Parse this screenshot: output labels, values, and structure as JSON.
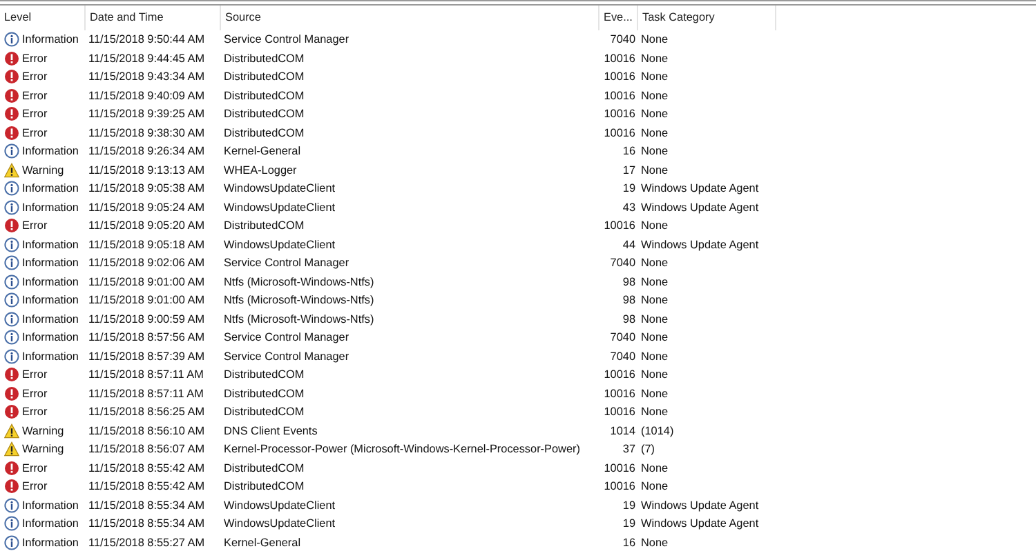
{
  "columns": [
    "Level",
    "Date and Time",
    "Source",
    "Eve...",
    "Task Category"
  ],
  "rows": [
    {
      "kind": "information",
      "level": "Information",
      "date": "11/15/2018 9:50:44 AM",
      "source": "Service Control Manager",
      "event": "7040",
      "task": "None"
    },
    {
      "kind": "error",
      "level": "Error",
      "date": "11/15/2018 9:44:45 AM",
      "source": "DistributedCOM",
      "event": "10016",
      "task": "None"
    },
    {
      "kind": "error",
      "level": "Error",
      "date": "11/15/2018 9:43:34 AM",
      "source": "DistributedCOM",
      "event": "10016",
      "task": "None"
    },
    {
      "kind": "error",
      "level": "Error",
      "date": "11/15/2018 9:40:09 AM",
      "source": "DistributedCOM",
      "event": "10016",
      "task": "None"
    },
    {
      "kind": "error",
      "level": "Error",
      "date": "11/15/2018 9:39:25 AM",
      "source": "DistributedCOM",
      "event": "10016",
      "task": "None"
    },
    {
      "kind": "error",
      "level": "Error",
      "date": "11/15/2018 9:38:30 AM",
      "source": "DistributedCOM",
      "event": "10016",
      "task": "None"
    },
    {
      "kind": "information",
      "level": "Information",
      "date": "11/15/2018 9:26:34 AM",
      "source": "Kernel-General",
      "event": "16",
      "task": "None"
    },
    {
      "kind": "warning",
      "level": "Warning",
      "date": "11/15/2018 9:13:13 AM",
      "source": "WHEA-Logger",
      "event": "17",
      "task": "None"
    },
    {
      "kind": "information",
      "level": "Information",
      "date": "11/15/2018 9:05:38 AM",
      "source": "WindowsUpdateClient",
      "event": "19",
      "task": "Windows Update Agent"
    },
    {
      "kind": "information",
      "level": "Information",
      "date": "11/15/2018 9:05:24 AM",
      "source": "WindowsUpdateClient",
      "event": "43",
      "task": "Windows Update Agent"
    },
    {
      "kind": "error",
      "level": "Error",
      "date": "11/15/2018 9:05:20 AM",
      "source": "DistributedCOM",
      "event": "10016",
      "task": "None"
    },
    {
      "kind": "information",
      "level": "Information",
      "date": "11/15/2018 9:05:18 AM",
      "source": "WindowsUpdateClient",
      "event": "44",
      "task": "Windows Update Agent"
    },
    {
      "kind": "information",
      "level": "Information",
      "date": "11/15/2018 9:02:06 AM",
      "source": "Service Control Manager",
      "event": "7040",
      "task": "None"
    },
    {
      "kind": "information",
      "level": "Information",
      "date": "11/15/2018 9:01:00 AM",
      "source": "Ntfs (Microsoft-Windows-Ntfs)",
      "event": "98",
      "task": "None"
    },
    {
      "kind": "information",
      "level": "Information",
      "date": "11/15/2018 9:01:00 AM",
      "source": "Ntfs (Microsoft-Windows-Ntfs)",
      "event": "98",
      "task": "None"
    },
    {
      "kind": "information",
      "level": "Information",
      "date": "11/15/2018 9:00:59 AM",
      "source": "Ntfs (Microsoft-Windows-Ntfs)",
      "event": "98",
      "task": "None"
    },
    {
      "kind": "information",
      "level": "Information",
      "date": "11/15/2018 8:57:56 AM",
      "source": "Service Control Manager",
      "event": "7040",
      "task": "None"
    },
    {
      "kind": "information",
      "level": "Information",
      "date": "11/15/2018 8:57:39 AM",
      "source": "Service Control Manager",
      "event": "7040",
      "task": "None"
    },
    {
      "kind": "error",
      "level": "Error",
      "date": "11/15/2018 8:57:11 AM",
      "source": "DistributedCOM",
      "event": "10016",
      "task": "None"
    },
    {
      "kind": "error",
      "level": "Error",
      "date": "11/15/2018 8:57:11 AM",
      "source": "DistributedCOM",
      "event": "10016",
      "task": "None"
    },
    {
      "kind": "error",
      "level": "Error",
      "date": "11/15/2018 8:56:25 AM",
      "source": "DistributedCOM",
      "event": "10016",
      "task": "None"
    },
    {
      "kind": "warning",
      "level": "Warning",
      "date": "11/15/2018 8:56:10 AM",
      "source": "DNS Client Events",
      "event": "1014",
      "task": "(1014)"
    },
    {
      "kind": "warning",
      "level": "Warning",
      "date": "11/15/2018 8:56:07 AM",
      "source": "Kernel-Processor-Power (Microsoft-Windows-Kernel-Processor-Power)",
      "event": "37",
      "task": "(7)"
    },
    {
      "kind": "error",
      "level": "Error",
      "date": "11/15/2018 8:55:42 AM",
      "source": "DistributedCOM",
      "event": "10016",
      "task": "None"
    },
    {
      "kind": "error",
      "level": "Error",
      "date": "11/15/2018 8:55:42 AM",
      "source": "DistributedCOM",
      "event": "10016",
      "task": "None"
    },
    {
      "kind": "information",
      "level": "Information",
      "date": "11/15/2018 8:55:34 AM",
      "source": "WindowsUpdateClient",
      "event": "19",
      "task": "Windows Update Agent"
    },
    {
      "kind": "information",
      "level": "Information",
      "date": "11/15/2018 8:55:34 AM",
      "source": "WindowsUpdateClient",
      "event": "19",
      "task": "Windows Update Agent"
    },
    {
      "kind": "information",
      "level": "Information",
      "date": "11/15/2018 8:55:27 AM",
      "source": "Kernel-General",
      "event": "16",
      "task": "None"
    }
  ]
}
